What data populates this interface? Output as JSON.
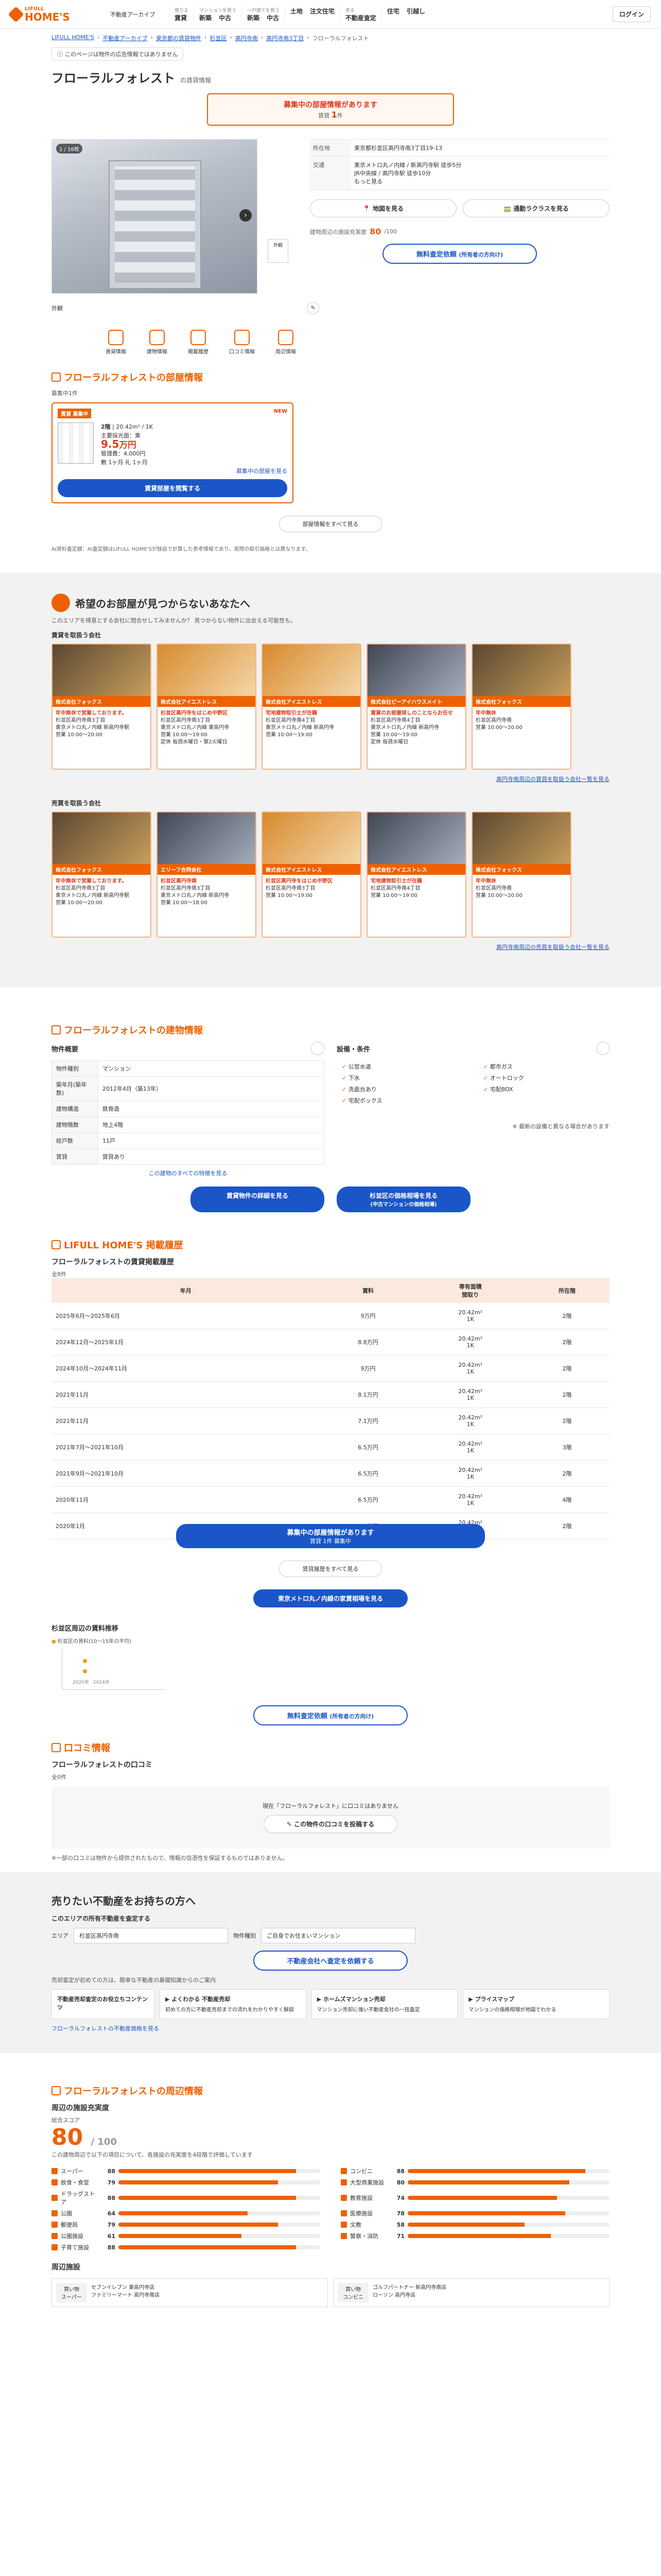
{
  "header": {
    "logo_small": "LIFULL",
    "logo_big": "HOME'S",
    "archive": "不動産アーカイブ",
    "nav": [
      {
        "cap": "借りる",
        "links": [
          "賃貸"
        ]
      },
      {
        "cap": "マンションを買う",
        "links": [
          "新築",
          "中古"
        ]
      },
      {
        "cap": "一戸建てを買う",
        "links": [
          "新築",
          "中古"
        ]
      },
      {
        "cap": "",
        "links": [
          "土地",
          "注文住宅"
        ]
      },
      {
        "cap": "売る",
        "links": [
          "不動産査定"
        ]
      },
      {
        "cap": "",
        "links": [
          "住宅",
          "引越し"
        ]
      }
    ],
    "login": "ログイン"
  },
  "breadcrumb": [
    "LIFULL HOME'S",
    "不動産アーカイブ",
    "東京都の賃貸物件",
    "杉並区",
    "高円寺南",
    "高円寺南3丁目",
    "フローラルフォレスト"
  ],
  "notice": "このページは物件の広告情報ではありません",
  "title": "フローラルフォレスト",
  "title_sub": "の賃貸情報",
  "promo": {
    "l1": "募集中の部屋情報があります",
    "l2_prefix": "賃貸",
    "count": "1",
    "l2_suffix": "件"
  },
  "gallery": {
    "count": "1 / 16枚",
    "thumb_label": "外観",
    "report": "外観"
  },
  "info": {
    "rows": [
      {
        "k": "所在地",
        "v": "東京都杉並区高円寺南3丁目19-13"
      },
      {
        "k": "交通",
        "v": "東京メトロ丸ノ内線 / 新高円寺駅 徒歩5分\nJR中央線 / 高円寺駅 徒歩10分\nもっと見る"
      }
    ],
    "btn_map": "地図を見る",
    "btn_commute": "通勤ラクラスを見る",
    "score_label": "建物周辺の施設充実度",
    "score": "80",
    "score_unit": "/100",
    "btn_valuation": "無料査定依頼",
    "btn_valuation_sub": "(所有者の方向け)"
  },
  "quick": [
    "賃貸情報",
    "建物情報",
    "掲載履歴",
    "口コミ情報",
    "周辺情報"
  ],
  "rooms": {
    "heading": "フローラルフォレストの部屋情報",
    "count": "募集中1件",
    "card": {
      "tag": "賃貸 募集中",
      "new": "NEW",
      "floor": "2階",
      "area": "20.42m²",
      "layout": "1K",
      "meta": "主要採光面：東",
      "price": "9.5",
      "price_unit": "万円",
      "mgmt": "管理費：4,000円",
      "deposit": "敷 1ヶ月",
      "key": "礼 1ヶ月",
      "more": "募集中の部屋を見る",
      "btn": "賃貸部屋を閲覧する"
    },
    "showall": "部屋情報をすべて見る",
    "note": "AI賃料査定額：AI査定額はLIFULL HOME'Sが独自で計算した参考情報であり、実際の取引価格とは異なります。"
  },
  "recommend": {
    "heading": "希望のお部屋が見つからないあなたへ",
    "sub": "このエリアを得意とする会社に問合せしてみませんか？ 見つからない物件に出会える可能性も。",
    "rent_title": "賃貸を取扱う会社",
    "rent": [
      {
        "name": "株式会社フォックス",
        "r": "年中無休で営業しております。",
        "t": "杉並区高円寺南3丁目\n東京メトロ丸ノ内線 新高円寺駅\n営業 10:00〜20:00",
        "img": "d"
      },
      {
        "name": "株式会社アイエストレス",
        "r": "杉並区高円寺をはじめ中野区",
        "t": "杉並区高円寺南3丁目\n東京メトロ丸ノ内線 東高円寺\n営業 10:00〜19:00\n定休 毎週水曜日・第2火曜日",
        "img": "o"
      },
      {
        "name": "株式会社アイエストレス",
        "r": "宅地建物取引士が在籍",
        "t": "杉並区高円寺南4丁目\n東京メトロ丸ノ内線 新高円寺\n営業 10:00〜19:00",
        "img": "o"
      },
      {
        "name": "株式会社ピーアイハウスメイト",
        "r": "賃貸のお部屋探しのことならお任せ",
        "t": "杉並区高円寺南4丁目\n東京メトロ丸ノ内線 新高円寺\n営業 10:00〜19:00\n定休 毎週水曜日",
        "img": "b"
      },
      {
        "name": "株式会社フォックス",
        "r": "年中無休",
        "t": "杉並区高円寺南\n営業 10:00〜20:00",
        "img": "d"
      }
    ],
    "rent_link": "高円寺南周辺の賃貸を取扱う会社一覧を見る",
    "sale_title": "売買を取扱う会社",
    "sale": [
      {
        "name": "株式会社フォックス",
        "r": "年中無休で営業しております。",
        "t": "杉並区高円寺南3丁目\n東京メトロ丸ノ内線 新高円寺駅\n営業 10:00〜20:00",
        "img": "d"
      },
      {
        "name": "エリーフ合同会社",
        "r": "杉並区高円寺南",
        "t": "杉並区高円寺南3丁目\n東京メトロ丸ノ内線 新高円寺\n営業 10:00〜18:00",
        "img": "b"
      },
      {
        "name": "株式会社アイエストレス",
        "r": "杉並区高円寺をはじめ中野区",
        "t": "杉並区高円寺南3丁目\n営業 10:00〜19:00",
        "img": "o"
      },
      {
        "name": "株式会社アイエストレス",
        "r": "宅地建物取引士が在籍",
        "t": "杉並区高円寺南4丁目\n営業 10:00〜19:00",
        "img": "b"
      },
      {
        "name": "株式会社フォックス",
        "r": "年中無休",
        "t": "杉並区高円寺南\n営業 10:00〜20:00",
        "img": "d"
      }
    ],
    "sale_link": "高円寺南周辺の売買を取扱う会社一覧を見る"
  },
  "building": {
    "heading": "フローラルフォレストの建物情報",
    "outline": "物件概要",
    "features_title": "設備・条件",
    "spec": [
      {
        "k": "物件種別",
        "v": "マンション"
      },
      {
        "k": "築年月(築年数)",
        "v": "2012年4月（築13年）"
      },
      {
        "k": "建物構造",
        "v": "鉄骨造"
      },
      {
        "k": "建物階数",
        "v": "地上4階"
      },
      {
        "k": "総戸数",
        "v": "11戸"
      },
      {
        "k": "賃貸",
        "v": "賃貸あり"
      }
    ],
    "features": [
      "公営水道",
      "都市ガス",
      "下水",
      "オートロック",
      "洗面台あり",
      "宅配BOX",
      "宅配ボックス",
      ""
    ],
    "spec_more": "この建物のすべての特徴を見る",
    "feat_note": "※ 最新の設備と異なる場合があります",
    "btn1": "賃貸物件の詳細を見る",
    "btn2": "杉並区の価格相場を見る",
    "btn2_sub": "(中古マンションの価格相場)"
  },
  "history": {
    "heading": "LIFULL HOME'S 掲載履歴",
    "sub": "フローラルフォレストの賃貸掲載履歴",
    "unit": "全8件",
    "cols": [
      "年月",
      "賃料",
      "専有面積\n間取り",
      "所在階"
    ],
    "rows": [
      [
        "2025年6月〜2025年6月",
        "9万円",
        "20.42m²\n1K",
        "2階"
      ],
      [
        "2024年12月〜2025年1月",
        "8.8万円",
        "20.42m²\n1K",
        "2階"
      ],
      [
        "2024年10月〜2024年11月",
        "9万円",
        "20.42m²\n1K",
        "2階"
      ],
      [
        "2021年11月",
        "8.1万円",
        "20.42m²\n1K",
        "2階"
      ],
      [
        "2021年11月",
        "7.1万円",
        "20.42m²\n1K",
        "2階"
      ],
      [
        "2021年7月〜2021年10月",
        "6.5万円",
        "20.42m²\n1K",
        "3階"
      ],
      [
        "2021年9月〜2021年10月",
        "6.5万円",
        "20.42m²\n1K",
        "2階"
      ],
      [
        "2020年11月",
        "6.5万円",
        "20.42m²\n1K",
        "4階"
      ],
      [
        "2020年1月",
        "6.5万円",
        "20.42m²\n1K",
        "2階"
      ]
    ],
    "promo_l1": "募集中の部屋情報があります",
    "promo_l2": "賃貸 1件 募集中",
    "showall": "賃貸履歴をすべて見る",
    "btn_metro": "東京メトロ丸ノ内線の家賃相場を見る"
  },
  "trend": {
    "title": "杉並区周辺の賃料推移",
    "legend": "杉並区の賃料(10〜15年の平均)",
    "labels": [
      "2025年",
      "2024年"
    ]
  },
  "trend_btn": "無料査定依頼",
  "trend_btn_sub": "(所有者の方向け)",
  "reviews": {
    "heading": "口コミ情報",
    "sub": "フローラルフォレストの口コミ",
    "count": "全0件",
    "empty": "現在「フローラルフォレスト」に口コミはありません",
    "btn": "この物件の口コミを投稿する",
    "note": "※一部の口コミは物件から提供されたもので、情報の信憑性を保証するものではありません。"
  },
  "sell": {
    "heading": "売りたい不動産をお持ちの方へ",
    "sub": "このエリアの所有不動産を査定する",
    "area_label": "エリア",
    "area": "杉並区高円寺南",
    "type_label": "物件種別",
    "type_placeholder": "ご自身でお住まいマンション",
    "btn": "不動産会社へ査定を依頼する",
    "note": "売却査定が初めての方は、簡単な不動産の基礎知識からのご案内",
    "cards_title": "不動産売却査定のお役立ちコンテンツ",
    "cards": [
      {
        "t": "よくわかる 不動産売却",
        "d": "初めての方に不動産売却までの流れをわかりやすく解説"
      },
      {
        "t": "ホームズマンション売却",
        "d": "マンション売却に強い不動産会社の一括査定"
      },
      {
        "t": "プライスマップ",
        "d": "マンションの価格相場が地図でわかる"
      }
    ],
    "link": "フローラルフォレストの不動産価格を見る"
  },
  "area": {
    "heading": "フローラルフォレストの周辺情報",
    "sub": "周辺の施設充実度",
    "score_label": "総合スコア",
    "score": "80",
    "score_total": "/ 100",
    "note": "この建物周辺で以下の項目について、各施設の充実度を4段階で評価しています",
    "bars": [
      {
        "n": "スーパー",
        "v": 88
      },
      {
        "n": "コンビニ",
        "v": 88
      },
      {
        "n": "飲食・食堂",
        "v": 79
      },
      {
        "n": "大型商業施設",
        "v": 80
      },
      {
        "n": "ドラッグストア",
        "v": 88
      },
      {
        "n": "教育施設",
        "v": 74
      },
      {
        "n": "公園",
        "v": 64
      },
      {
        "n": "医療施設",
        "v": 78
      },
      {
        "n": "郵便局",
        "v": 79
      },
      {
        "n": "文教",
        "v": 58
      },
      {
        "n": "公園施設",
        "v": 61
      },
      {
        "n": "警察・消防",
        "v": 71
      },
      {
        "n": "子育て施設",
        "v": 88
      },
      {
        "n": "",
        "v": 0
      }
    ],
    "nearby_title": "周辺施設",
    "nearby": [
      {
        "lb": "買い物\nスーパー",
        "t": "セブンイレブン 東高円寺店\nファミリーマート 高円寺南店"
      },
      {
        "lb": "買い物\nコンビニ",
        "t": "ゴルフパートナー 新高円寺南店\nローソン 高円寺店"
      }
    ]
  },
  "colors": {
    "brand": "#ed6103",
    "blue": "#1a56c7",
    "red": "#e03b1a"
  }
}
